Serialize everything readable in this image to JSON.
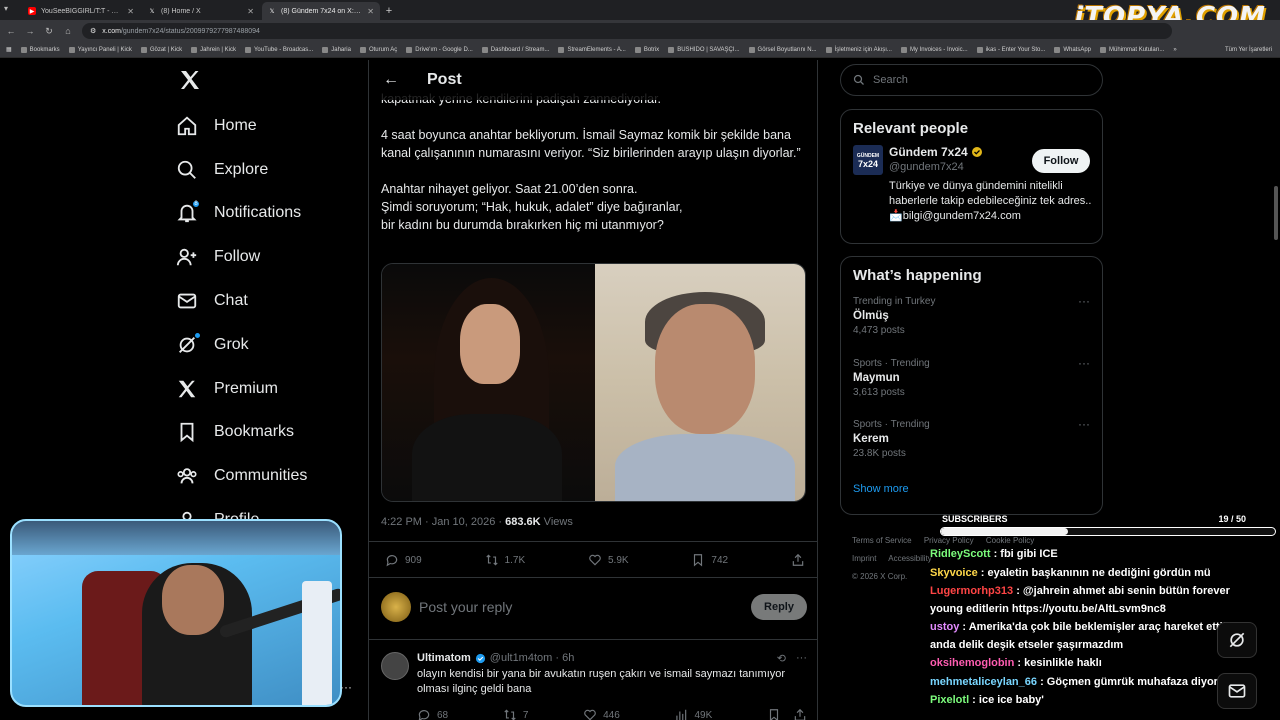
{
  "browser": {
    "tabs": [
      {
        "title": "YouSeeBIGGIRL/T:T - YouTube",
        "color": "#ff0000",
        "active": false
      },
      {
        "title": "(8) Home / X",
        "color": "#000000",
        "active": false
      },
      {
        "title": "(8) Gündem 7x24 on X: \"Avukat",
        "color": "#000000",
        "active": true
      }
    ],
    "url_host": "x.com",
    "url_path": "/gundem7x24/status/2009979277987488094",
    "watermark": "iTOPYA.COM",
    "bookmarks": [
      "Bookmarks",
      "Yayıncı Paneli | Kick",
      "Gözat | Kick",
      "Jahrein | Kick",
      "YouTube - Broadcas...",
      "Jaharia",
      "Oturum Aç",
      "Drive'ım - Google D...",
      "Dashboard / Stream...",
      "StreamElements - A...",
      "Botrix",
      "BUSHIDO | SAVAŞÇI...",
      "Görsel Boyutlarını N...",
      "İşletmeniz için Akıșı...",
      "My Invoices - Invoic...",
      "ikas - Enter Your Sto...",
      "WhatsApp",
      "Mühimmat Kutuları..."
    ],
    "bookmarks_more": "»",
    "all_bookmarks": "Tüm Yer İşaretleri"
  },
  "nav": {
    "items": [
      {
        "label": "Home",
        "icon": "home-icon"
      },
      {
        "label": "Explore",
        "icon": "search-icon"
      },
      {
        "label": "Notifications",
        "icon": "bell-icon",
        "badge": "8"
      },
      {
        "label": "Follow",
        "icon": "follow-icon"
      },
      {
        "label": "Chat",
        "icon": "mail-icon"
      },
      {
        "label": "Grok",
        "icon": "grok-icon"
      },
      {
        "label": "Premium",
        "icon": "x-icon"
      },
      {
        "label": "Bookmarks",
        "icon": "bookmark-icon"
      },
      {
        "label": "Communities",
        "icon": "communities-icon"
      },
      {
        "label": "Profile",
        "icon": "profile-icon"
      }
    ]
  },
  "post": {
    "header_title": "Post",
    "text": "kapatmak yerine kendilerini padişah zannediyorlar.\n\n4 saat boyunca anahtar bekliyorum. İsmail Saymaz komik bir şekilde bana kanal çalışanının numarasını veriyor. “Siz birilerinden arayıp ulaşın diyorlar.”\n\nAnahtar nihayet geliyor. Saat 21.00’den sonra.\nŞimdi soruyorum; “Hak, hukuk, adalet” diye bağıranlar,\nbir kadını bu durumda bırakırken hiç mi utanmıyor?",
    "time": "4:22 PM · Jan 10, 2026 · ",
    "views_count": "683.6K",
    "views_label": " Views",
    "stats": {
      "replies": "909",
      "reposts": "1.7K",
      "likes": "5.9K",
      "bookmarks": "742"
    },
    "reply_placeholder": "Post your reply",
    "reply_button": "Reply"
  },
  "comment": {
    "name": "Ultimatom",
    "handle": "@ult1m4tom · 6h",
    "text": "olayın kendisi bir yana bir avukatın ruşen çakırı ve ismail saymazı tanımıyor olması ilginç geldi bana",
    "replies": "68",
    "reposts": "7",
    "likes": "446",
    "views": "49K"
  },
  "sidebar": {
    "search_placeholder": "Search",
    "relevant_title": "Relevant people",
    "person": {
      "name": "Gündem 7x24",
      "handle": "@gundem7x24",
      "bio": "Türkiye ve dünya gündemini nitelikli haberlerle takip edebileceğiniz tek adres.. 📩bilgi@gundem7x24.com",
      "follow_label": "Follow",
      "avatar_top": "GÜNDEM",
      "avatar_bottom": "7x24"
    },
    "happening_title": "What’s happening",
    "trends": [
      {
        "context": "Trending in Turkey",
        "name": "Ölmüş",
        "count": "4,473 posts"
      },
      {
        "context": "Sports · Trending",
        "name": "Maymun",
        "count": "3,613 posts"
      },
      {
        "context": "Sports · Trending",
        "name": "Kerem",
        "count": "23.8K posts"
      }
    ],
    "show_more": "Show more",
    "footer_links": [
      "Terms of Service",
      "Privacy Policy",
      "Cookie Policy",
      "Imprint",
      "Accessibility"
    ],
    "copyright": "© 2026 X Corp."
  },
  "stream": {
    "subs_label": "SUBSCRIBERS",
    "subs_count": "19 / 50",
    "subs_progress": 0.38,
    "chat": [
      {
        "user": "RidleyScott",
        "color": "#7cfc7c",
        "text": "fbi gibi ICE"
      },
      {
        "user": "Skyvoice",
        "color": "#ffd84a",
        "text": "eyaletin başkanının ne dediğini gördün mü"
      },
      {
        "user": "Lugermorhp313",
        "color": "#ff4545",
        "text": "@jahrein ahmet abi senin bütün forever young editlerin https://youtu.be/AltLsvm9nc8"
      },
      {
        "user": "ustoy",
        "color": "#e38cff",
        "text": "Amerika'da çok bile beklemişler araç hareket ettiği anda delik deşik etseler şaşırmazdım"
      },
      {
        "user": "oksihemoglobin",
        "color": "#ff5db1",
        "text": "kesinlikle haklı"
      },
      {
        "user": "mehmetaliceylan_66",
        "color": "#79d6ff",
        "text": "Göçmen gümrük muhafaza diyorlar"
      },
      {
        "user": "Pixelotl",
        "color": "#7cfc7c",
        "text": "ice ice baby'"
      }
    ]
  }
}
